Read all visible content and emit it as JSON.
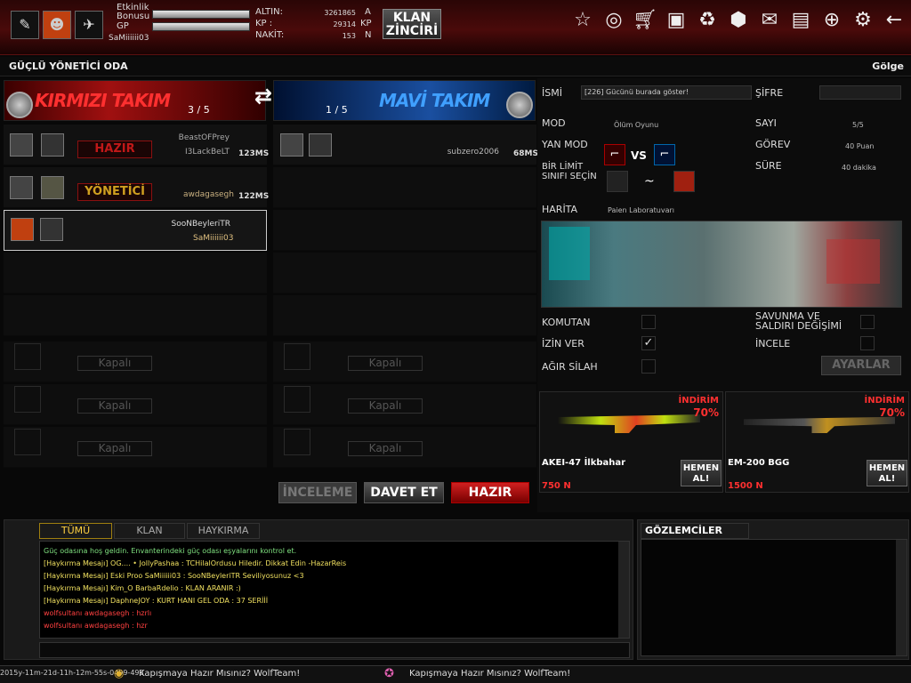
{
  "top": {
    "event_bonus_label": "Etkinlik Bonusu",
    "gp_label": "GP",
    "player_name": "SaMiiiiii03",
    "altin_label": "ALTIN:",
    "altin_value": "3261865",
    "altin_unit": "A",
    "kp_label": "KP :",
    "kp_value": "29314",
    "kp_unit": "KP",
    "nakit_label": "NAKİT:",
    "nakit_value": "153",
    "nakit_unit": "N",
    "klan_button": "KLAN ZİNCİRİ"
  },
  "room": {
    "title": "GÜÇLÜ YÖNETİCİ ODA",
    "golge": "Gölge"
  },
  "teams": {
    "red_name": "KIRMIZI TAKIM",
    "red_count": "3 / 5",
    "blue_name": "MAVİ TAKIM",
    "blue_count": "1 / 5",
    "red_players": [
      {
        "name": "BeastOFPrey",
        "sub": "I3LackBeLT",
        "status": "HAZIR",
        "ms": "123MS"
      },
      {
        "name": "awdagasegh",
        "status": "YÖNETİCİ",
        "ms": "122MS"
      },
      {
        "name": "SooNBeyleriTR",
        "sub": "SaMiiiiii03"
      }
    ],
    "blue_players": [
      {
        "name": "subzero2006",
        "ms": "68MS"
      }
    ],
    "closed_label": "Kapalı"
  },
  "settings": {
    "isim_label": "İSMİ",
    "isim_value": "[226] Gücünü burada göster!",
    "sifre_label": "ŞİFRE",
    "mod_label": "MOD",
    "mod_value": "Ölüm Oyunu",
    "sayi_label": "SAYI",
    "sayi_value": "5/5",
    "yanmod_label": "YAN MOD",
    "vs_label": "VS",
    "gorev_label": "GÖREV",
    "gorev_value": "40 Puan",
    "limit_label": "BİR LİMİT SINIFI SEÇİN",
    "tilde": "~",
    "sure_label": "SÜRE",
    "sure_value": "40 dakika",
    "harita_label": "HARİTA",
    "harita_value": "Paien Laboratuvarı",
    "komutan_label": "KOMUTAN",
    "izinver_label": "İZİN VER",
    "agirsilah_label": "AĞIR SİLAH",
    "savunma_label": "SAVUNMA VE SALDIRI DEĞİŞİMİ",
    "incele_label": "İNCELE",
    "ayarlar_label": "AYARLAR",
    "izinver_checked": true
  },
  "shop": [
    {
      "name": "AKEI-47 İlkbahar",
      "discount_label": "İNDİRİM",
      "discount": "70%",
      "price": "750 N",
      "buy": "HEMEN AL!"
    },
    {
      "name": "EM-200 BGG",
      "discount_label": "İNDİRİM",
      "discount": "70%",
      "price": "1500 N",
      "buy": "HEMEN AL!"
    }
  ],
  "actions": {
    "inceleme": "İNCELEME",
    "davet": "DAVET ET",
    "hazir": "HAZIR"
  },
  "chat": {
    "tabs": [
      "TÜMÜ",
      "KLAN",
      "HAYKIRMA"
    ],
    "lines": [
      {
        "text": "Güç odasına hoş geldin. Envanterindeki güç odası eşyalarını kontrol et.",
        "color": "#7fe07f"
      },
      {
        "text": "[Haykırma Mesajı] OG.... • JollyPashaa : TCHilalOrdusu Hiledir. Dikkat Edin -HazarReis",
        "color": "#f0e060"
      },
      {
        "text": "[Haykırma Mesajı] Eski Proo SaMiiiiii03 : SooNBeyleriTR Seviliyosunuz <3",
        "color": "#f0e060"
      },
      {
        "text": "[Haykırma Mesajı] Kim_O BarbaRdelio : KLAN ARANIR :)",
        "color": "#f0e060"
      },
      {
        "text": "[Haykırma Mesajı] DaphneJOY : KURT HANI GEL ODA : 37 SERİİİ",
        "color": "#f0e060"
      },
      {
        "text": "wolfsultanı awdagasegh : hzrlı",
        "color": "#ff4040"
      },
      {
        "text": "wolfsultanı awdagasegh : hzr",
        "color": "#ff4040"
      }
    ],
    "observers_label": "GÖZLEMCİLER"
  },
  "status": {
    "left": "2015y-11m-21d-11h-12m-55s-0499-493",
    "ticker1": "Kapışmaya Hazır Mısınız? WolfTeam!",
    "ticker2": "Kapışmaya Hazır Mısınız? WolfTeam!"
  },
  "colors": {
    "red": "#c01818",
    "blue": "#2a70d0",
    "gold": "#d0a020"
  }
}
